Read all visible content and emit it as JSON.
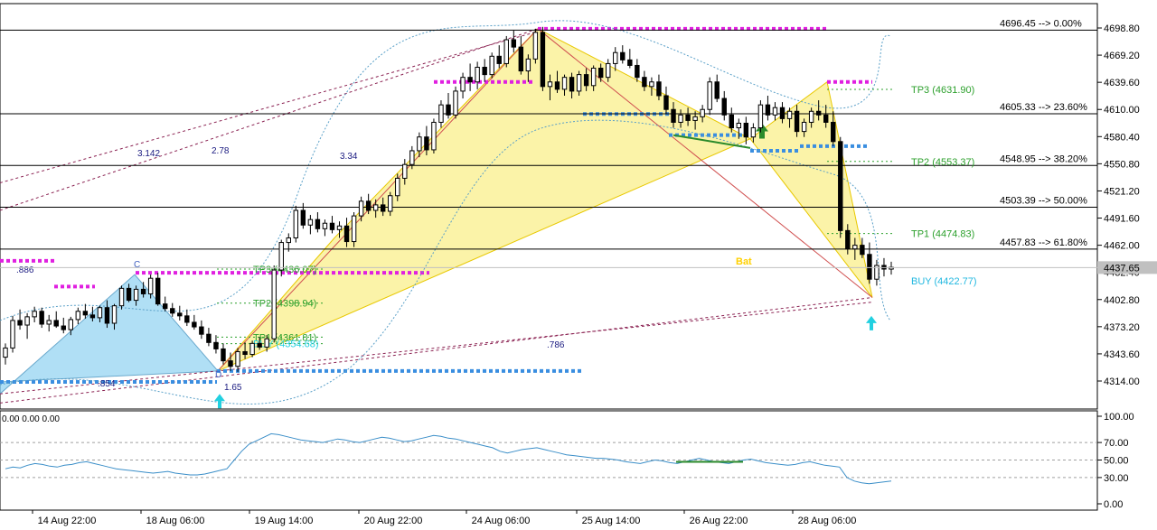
{
  "chart_data": [
    {
      "type": "candlestick",
      "y_ticks": [
        "4698.80",
        "4669.20",
        "4639.60",
        "4610.00",
        "4580.40",
        "4550.80",
        "4521.20",
        "4491.60",
        "4462.00",
        "4432.40",
        "4402.80",
        "4373.20",
        "4343.60",
        "4314.00"
      ],
      "ylim": [
        4290,
        4720
      ],
      "x_ticks": [
        "14 Aug 22:00",
        "18 Aug 06:00",
        "19 Aug 14:00",
        "20 Aug 22:00",
        "24 Aug 06:00",
        "25 Aug 14:00",
        "26 Aug 22:00",
        "28 Aug 06:00"
      ],
      "current_price": "4437.65",
      "fib_levels": [
        {
          "label": "4696.45 --> 0.00%",
          "value": 4696.45
        },
        {
          "label": "4605.33 --> 23.60%",
          "value": 4605.33
        },
        {
          "label": "4548.95 --> 38.20%",
          "value": 4548.95
        },
        {
          "label": "4503.39 --> 50.00%",
          "value": 4503.39
        },
        {
          "label": "4457.83 --> 61.80%",
          "value": 4457.83
        }
      ],
      "targets": [
        {
          "label": "TP3 (4631.90)",
          "value": 4631.9
        },
        {
          "label": "TP2 (4553.37)",
          "value": 4553.37
        },
        {
          "label": "TP1 (4474.83)",
          "value": 4474.83
        }
      ],
      "buy_label": "BUY (4422.77)",
      "left_targets": [
        {
          "label": "TP3 (4436.07)",
          "value": 4436.07
        },
        {
          "label": "TP2 (4398.94)",
          "value": 4398.94
        },
        {
          "label": "TP1 (4361.81)",
          "value": 4361.81
        },
        {
          "label": "BUY (4354.68)",
          "value": 4354.68
        }
      ],
      "pattern_name": "Bat",
      "ratio_labels": [
        "3.142",
        "2.78",
        "3.34",
        ".886",
        ".786",
        ".854",
        "1.65"
      ],
      "point_labels": [
        "C",
        "D"
      ],
      "candles": [
        [
          4340,
          4355,
          4332,
          4350
        ],
        [
          4350,
          4385,
          4345,
          4380
        ],
        [
          4380,
          4392,
          4370,
          4375
        ],
        [
          4375,
          4388,
          4360,
          4384
        ],
        [
          4384,
          4395,
          4378,
          4390
        ],
        [
          4390,
          4394,
          4372,
          4376
        ],
        [
          4376,
          4386,
          4368,
          4380
        ],
        [
          4380,
          4390,
          4372,
          4374
        ],
        [
          4374,
          4383,
          4366,
          4370
        ],
        [
          4370,
          4384,
          4364,
          4381
        ],
        [
          4381,
          4394,
          4376,
          4390
        ],
        [
          4390,
          4398,
          4382,
          4386
        ],
        [
          4386,
          4395,
          4379,
          4383
        ],
        [
          4383,
          4396,
          4378,
          4394
        ],
        [
          4394,
          4402,
          4372,
          4377
        ],
        [
          4377,
          4398,
          4370,
          4396
        ],
        [
          4396,
          4418,
          4392,
          4415
        ],
        [
          4415,
          4420,
          4400,
          4402
        ],
        [
          4402,
          4418,
          4396,
          4414
        ],
        [
          4414,
          4422,
          4405,
          4409
        ],
        [
          4409,
          4430,
          4404,
          4426
        ],
        [
          4426,
          4432,
          4396,
          4398
        ],
        [
          4398,
          4406,
          4390,
          4393
        ],
        [
          4393,
          4399,
          4384,
          4388
        ],
        [
          4388,
          4396,
          4380,
          4385
        ],
        [
          4385,
          4392,
          4374,
          4378
        ],
        [
          4378,
          4386,
          4370,
          4373
        ],
        [
          4373,
          4380,
          4360,
          4365
        ],
        [
          4365,
          4372,
          4352,
          4356
        ],
        [
          4356,
          4364,
          4344,
          4349
        ],
        [
          4349,
          4355,
          4332,
          4336
        ],
        [
          4336,
          4345,
          4325,
          4330
        ],
        [
          4330,
          4350,
          4324,
          4346
        ],
        [
          4346,
          4356,
          4338,
          4343
        ],
        [
          4343,
          4358,
          4340,
          4355
        ],
        [
          4355,
          4362,
          4348,
          4351
        ],
        [
          4351,
          4364,
          4346,
          4360
        ],
        [
          4360,
          4440,
          4356,
          4435
        ],
        [
          4435,
          4468,
          4428,
          4465
        ],
        [
          4465,
          4475,
          4455,
          4470
        ],
        [
          4470,
          4505,
          4465,
          4500
        ],
        [
          4500,
          4508,
          4480,
          4484
        ],
        [
          4484,
          4495,
          4474,
          4490
        ],
        [
          4490,
          4498,
          4476,
          4480
        ],
        [
          4480,
          4490,
          4472,
          4486
        ],
        [
          4486,
          4494,
          4475,
          4479
        ],
        [
          4479,
          4488,
          4470,
          4483
        ],
        [
          4483,
          4492,
          4460,
          4466
        ],
        [
          4466,
          4498,
          4460,
          4494
        ],
        [
          4494,
          4515,
          4488,
          4510
        ],
        [
          4510,
          4518,
          4496,
          4500
        ],
        [
          4500,
          4512,
          4492,
          4506
        ],
        [
          4506,
          4514,
          4494,
          4499
        ],
        [
          4499,
          4520,
          4494,
          4516
        ],
        [
          4516,
          4540,
          4510,
          4535
        ],
        [
          4535,
          4556,
          4528,
          4550
        ],
        [
          4550,
          4570,
          4545,
          4565
        ],
        [
          4565,
          4585,
          4558,
          4580
        ],
        [
          4580,
          4592,
          4560,
          4566
        ],
        [
          4566,
          4600,
          4562,
          4596
        ],
        [
          4596,
          4620,
          4590,
          4615
        ],
        [
          4615,
          4628,
          4600,
          4604
        ],
        [
          4604,
          4635,
          4600,
          4630
        ],
        [
          4630,
          4650,
          4622,
          4645
        ],
        [
          4645,
          4660,
          4630,
          4640
        ],
        [
          4640,
          4662,
          4632,
          4656
        ],
        [
          4656,
          4665,
          4640,
          4648
        ],
        [
          4648,
          4672,
          4644,
          4668
        ],
        [
          4668,
          4680,
          4655,
          4660
        ],
        [
          4660,
          4690,
          4656,
          4686
        ],
        [
          4686,
          4696,
          4672,
          4678
        ],
        [
          4678,
          4690,
          4648,
          4652
        ],
        [
          4652,
          4670,
          4640,
          4665
        ],
        [
          4665,
          4698,
          4660,
          4694
        ],
        [
          4694,
          4700,
          4630,
          4635
        ],
        [
          4635,
          4648,
          4620,
          4640
        ],
        [
          4640,
          4652,
          4628,
          4632
        ],
        [
          4632,
          4648,
          4625,
          4645
        ],
        [
          4645,
          4650,
          4622,
          4630
        ],
        [
          4630,
          4652,
          4625,
          4648
        ],
        [
          4648,
          4655,
          4630,
          4636
        ],
        [
          4636,
          4658,
          4630,
          4655
        ],
        [
          4655,
          4660,
          4640,
          4645
        ],
        [
          4645,
          4665,
          4640,
          4660
        ],
        [
          4660,
          4678,
          4652,
          4672
        ],
        [
          4672,
          4680,
          4660,
          4664
        ],
        [
          4664,
          4676,
          4655,
          4658
        ],
        [
          4658,
          4665,
          4640,
          4645
        ],
        [
          4645,
          4652,
          4630,
          4635
        ],
        [
          4635,
          4645,
          4625,
          4640
        ],
        [
          4640,
          4648,
          4620,
          4625
        ],
        [
          4625,
          4635,
          4605,
          4610
        ],
        [
          4610,
          4618,
          4590,
          4596
        ],
        [
          4596,
          4610,
          4590,
          4604
        ],
        [
          4604,
          4612,
          4592,
          4598
        ],
        [
          4598,
          4608,
          4588,
          4602
        ],
        [
          4602,
          4615,
          4596,
          4610
        ],
        [
          4610,
          4645,
          4604,
          4640
        ],
        [
          4640,
          4648,
          4618,
          4622
        ],
        [
          4622,
          4630,
          4598,
          4604
        ],
        [
          4604,
          4612,
          4585,
          4590
        ],
        [
          4590,
          4600,
          4578,
          4595
        ],
        [
          4595,
          4602,
          4572,
          4580
        ],
        [
          4580,
          4595,
          4574,
          4590
        ],
        [
          4590,
          4620,
          4585,
          4615
        ],
        [
          4615,
          4625,
          4598,
          4604
        ],
        [
          4604,
          4618,
          4598,
          4612
        ],
        [
          4612,
          4618,
          4595,
          4600
        ],
        [
          4600,
          4612,
          4590,
          4608
        ],
        [
          4608,
          4615,
          4580,
          4586
        ],
        [
          4586,
          4600,
          4580,
          4596
        ],
        [
          4596,
          4612,
          4590,
          4608
        ],
        [
          4608,
          4620,
          4598,
          4604
        ],
        [
          4604,
          4615,
          4590,
          4596
        ],
        [
          4596,
          4608,
          4570,
          4575
        ],
        [
          4575,
          4580,
          4470,
          4478
        ],
        [
          4478,
          4485,
          4452,
          4458
        ],
        [
          4458,
          4470,
          4446,
          4462
        ],
        [
          4462,
          4470,
          4448,
          4452
        ],
        [
          4452,
          4465,
          4420,
          4425
        ],
        [
          4425,
          4446,
          4418,
          4440
        ],
        [
          4440,
          4448,
          4428,
          4436
        ],
        [
          4436,
          4444,
          4430,
          4438
        ]
      ],
      "rsi": {
        "ticks": [
          "100.00",
          "70.00",
          "50.00",
          "30.00",
          "0.00"
        ],
        "label": "0.00 0.00 0.00",
        "values": [
          40,
          42,
          41,
          44,
          46,
          45,
          43,
          42,
          44,
          45,
          47,
          48,
          46,
          44,
          42,
          40,
          39,
          38,
          37,
          36,
          35,
          36,
          37,
          35,
          34,
          33,
          33,
          34,
          36,
          38,
          40,
          50,
          60,
          68,
          72,
          76,
          80,
          79,
          77,
          75,
          73,
          72,
          71,
          70,
          72,
          74,
          73,
          71,
          70,
          72,
          74,
          76,
          75,
          73,
          71,
          72,
          74,
          76,
          78,
          77,
          75,
          74,
          72,
          70,
          68,
          66,
          64,
          60,
          58,
          60,
          62,
          63,
          64,
          62,
          60,
          58,
          56,
          55,
          54,
          53,
          52,
          52,
          51,
          50,
          48,
          47,
          46,
          48,
          50,
          49,
          47,
          46,
          48,
          50,
          52,
          50,
          48,
          47,
          46,
          48,
          50,
          51,
          49,
          47,
          46,
          45,
          44,
          45,
          47,
          48,
          46,
          44,
          43,
          42,
          30,
          26,
          24,
          23,
          24,
          25,
          26
        ]
      }
    }
  ]
}
